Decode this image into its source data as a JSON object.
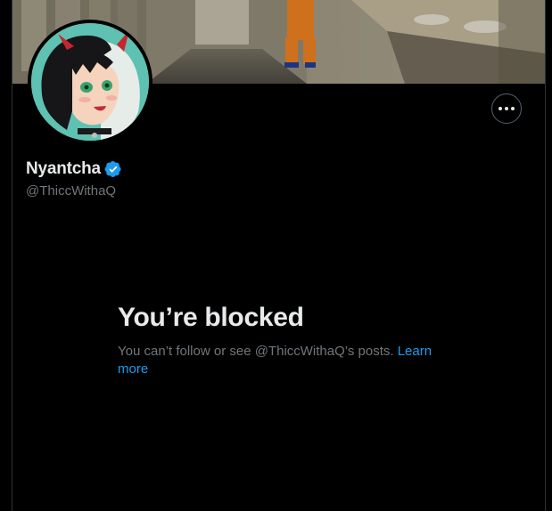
{
  "profile": {
    "display_name": "Nyantcha",
    "handle": "@ThiccWithaQ",
    "verified": true,
    "verified_icon": "verified-badge-icon",
    "avatar_icon": "avatar-image",
    "banner_icon": "banner-image"
  },
  "header": {
    "more_icon": "more-options-icon"
  },
  "blocked": {
    "title": "You’re blocked",
    "message": "You can’t follow or see @ThiccWithaQ’s posts.",
    "learn_more_label": "Learn more"
  },
  "colors": {
    "background": "#000000",
    "primary_text": "#e7e9ea",
    "secondary_text": "#71767b",
    "link": "#1d9bf0",
    "verified": "#1d9bf0",
    "border": "#2f3336"
  }
}
